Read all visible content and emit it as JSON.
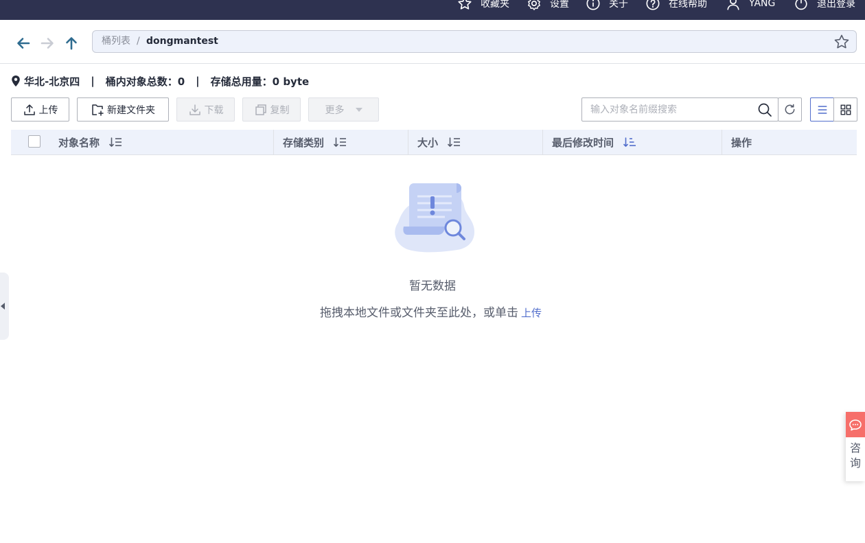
{
  "topbar": {
    "favorites": "收藏夹",
    "settings": "设置",
    "about": "关于",
    "help": "在线帮助",
    "user": "YANG",
    "logout": "退出登录"
  },
  "nav": {
    "breadcrumb_root": "桶列表",
    "breadcrumb_sep": "/",
    "breadcrumb_current": "dongmantest"
  },
  "info": {
    "region": "华北-北京四",
    "sep": "|",
    "object_count": "桶内对象总数：0",
    "storage_used": "存储总用量：0 byte"
  },
  "toolbar": {
    "upload": "上传",
    "new_folder": "新建文件夹",
    "download": "下载",
    "copy": "复制",
    "more": "更多",
    "search_placeholder": "输入对象名前缀搜索"
  },
  "table": {
    "columns": [
      "对象名称",
      "存储类别",
      "大小",
      "最后修改时间",
      "操作"
    ]
  },
  "empty": {
    "title": "暂无数据",
    "hint": "拖拽本地文件或文件夹至此处，或单击",
    "upload_link": "上传"
  },
  "consult": {
    "label": "咨询"
  },
  "colors": {
    "topbar_bg": "#2e3250",
    "accent": "#526ecc",
    "header_bg": "#eef2fb",
    "consult_red": "#f66f6a"
  }
}
